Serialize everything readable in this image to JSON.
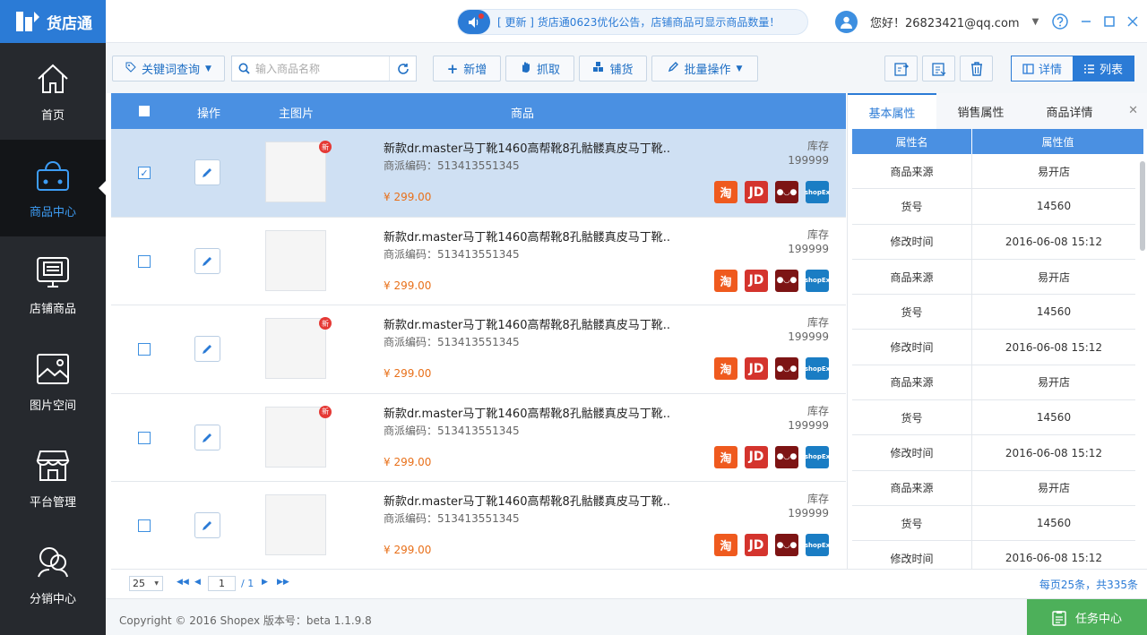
{
  "app": {
    "name": "货店通"
  },
  "sidebar": {
    "items": [
      {
        "label": "首页",
        "icon": "home-icon"
      },
      {
        "label": "商品中心",
        "icon": "basket-icon"
      },
      {
        "label": "店铺商品",
        "icon": "shop-goods-icon"
      },
      {
        "label": "图片空间",
        "icon": "image-icon"
      },
      {
        "label": "平台管理",
        "icon": "store-icon"
      },
      {
        "label": "分销中心",
        "icon": "users-icon"
      }
    ]
  },
  "topbar": {
    "notice": "[ 更新 ]  货店通0623优化公告，店铺商品可显示商品数量！",
    "user": "您好！26823421@qq.com"
  },
  "toolbar": {
    "keyword_btn": "关键词查询",
    "search_placeholder": "输入商品名称",
    "add": "新增",
    "grab": "抓取",
    "distribute": "铺货",
    "batch": "批量操作",
    "detail": "详情",
    "list": "列表"
  },
  "table": {
    "headers": {
      "op": "操作",
      "img": "主图片",
      "product": "商品"
    },
    "rows": [
      {
        "title": "新款dr.master马丁靴1460高帮靴8孔骷髅真皮马丁靴...",
        "code": "商派编码：513413551345",
        "price": "¥ 299.00",
        "stock_label": "库存",
        "stock": "199999",
        "selected": true,
        "is_new": true
      },
      {
        "title": "新款dr.master马丁靴1460高帮靴8孔骷髅真皮马丁靴...",
        "code": "商派编码：513413551345",
        "price": "¥ 299.00",
        "stock_label": "库存",
        "stock": "199999",
        "selected": false,
        "is_new": false
      },
      {
        "title": "新款dr.master马丁靴1460高帮靴8孔骷髅真皮马丁靴...",
        "code": "商派编码：513413551345",
        "price": "¥ 299.00",
        "stock_label": "库存",
        "stock": "199999",
        "selected": false,
        "is_new": true
      },
      {
        "title": "新款dr.master马丁靴1460高帮靴8孔骷髅真皮马丁靴...",
        "code": "商派编码：513413551345",
        "price": "¥ 299.00",
        "stock_label": "库存",
        "stock": "199999",
        "selected": false,
        "is_new": true
      },
      {
        "title": "新款dr.master马丁靴1460高帮靴8孔骷髅真皮马丁靴...",
        "code": "商派编码：513413551345",
        "price": "¥ 299.00",
        "stock_label": "库存",
        "stock": "199999",
        "selected": false,
        "is_new": false
      }
    ],
    "badge_new": "新",
    "platforms": {
      "taobao": "淘",
      "jd": "JD",
      "shopex": "shopEx"
    }
  },
  "pager": {
    "page_size": "25",
    "page": "1",
    "total_pages": "/ 1",
    "info": "每页25条，共335条"
  },
  "panel": {
    "tabs": [
      "基本属性",
      "销售属性",
      "商品详情"
    ],
    "head": {
      "name": "属性名",
      "value": "属性值"
    },
    "rows": [
      {
        "name": "商品来源",
        "value": "易开店"
      },
      {
        "name": "货号",
        "value": "14560"
      },
      {
        "name": "修改时间",
        "value": "2016-06-08 15:12"
      },
      {
        "name": "商品来源",
        "value": "易开店"
      },
      {
        "name": "货号",
        "value": "14560"
      },
      {
        "name": "修改时间",
        "value": "2016-06-08 15:12"
      },
      {
        "name": "商品来源",
        "value": "易开店"
      },
      {
        "name": "货号",
        "value": "14560"
      },
      {
        "name": "修改时间",
        "value": "2016-06-08 15:12"
      },
      {
        "name": "商品来源",
        "value": "易开店"
      },
      {
        "name": "货号",
        "value": "14560"
      },
      {
        "name": "修改时间",
        "value": "2016-06-08 15:12"
      }
    ]
  },
  "footer": {
    "copyright": "Copyright © 2016 Shopex   版本号：beta 1.1.9.8",
    "task": "任务中心"
  },
  "colors": {
    "primary": "#2b7bd6",
    "header_blue": "#4a90e2",
    "sidebar": "#26292e",
    "price": "#e8701a",
    "task_green": "#4db05a"
  }
}
